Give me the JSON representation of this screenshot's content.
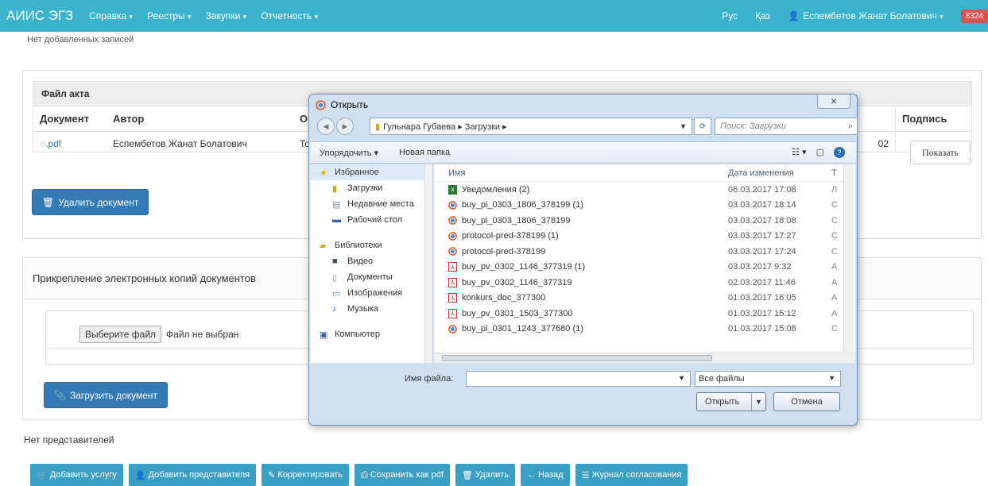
{
  "navbar": {
    "brand": "АИИС ЭГЗ",
    "menus": [
      "Справка",
      "Реестры",
      "Закупки",
      "Отчетность"
    ],
    "lang_ru": "Рус",
    "lang_kz": "Қаз",
    "user": "Еспембетов Жанат Болатович",
    "badge": "8324"
  },
  "top_note": "Нет добавленных записей",
  "act_table": {
    "title": "Файл акта",
    "headers": [
      "Документ",
      "Автор",
      "Ор",
      "",
      "Подпись"
    ],
    "row": {
      "doc": "◌.pdf",
      "author": "Еспембетов Жанат Болатович",
      "org": "То",
      "date_tail": "02"
    },
    "show_button": "Показать"
  },
  "delete_doc_button": "Удалить документ",
  "attach_panel": {
    "title": "Прикрепление электронных копий документов",
    "choose_button": "Выберите файл",
    "no_file": "Файл не выбран",
    "upload_button": "Загрузить документ"
  },
  "no_reps": "Нет представителей",
  "bottom_buttons": [
    "Добавить услугу",
    "Добавить представителя",
    "Корректировать",
    "Сохранить как pdf",
    "Удалить",
    "Назад",
    "Журнал согласования"
  ],
  "dialog": {
    "title": "Открыть",
    "close_label": "⨯",
    "path": "Гульнара Губаева ▸ Загрузки ▸",
    "search_placeholder": "Поиск: Загрузки",
    "organize": "Упорядочить ▾",
    "new_folder": "Новая папка",
    "nav": {
      "favorites": "Избранное",
      "fav_items": [
        "Загрузки",
        "Недавние места",
        "Рабочий стол"
      ],
      "libraries": "Библиотеки",
      "lib_items": [
        "Видео",
        "Документы",
        "Изображения",
        "Музыка"
      ],
      "computer": "Компьютер"
    },
    "col_name": "Имя",
    "col_date": "Дата изменения",
    "files": [
      {
        "name": "Уведомления (2)",
        "date": "06.03.2017 17:08",
        "icon": "xls-icon",
        "type": "Л"
      },
      {
        "name": "buy_pi_0303_1806_378199 (1)",
        "date": "03.03.2017 18:14",
        "icon": "chrome-icon",
        "type": "С"
      },
      {
        "name": "buy_pi_0303_1806_378199",
        "date": "03.03.2017 18:08",
        "icon": "chrome-icon",
        "type": "С"
      },
      {
        "name": "protocol-pred-378199 (1)",
        "date": "03.03.2017 17:27",
        "icon": "chrome-icon",
        "type": "С"
      },
      {
        "name": "protocol-pred-378199",
        "date": "03.03.2017 17:24",
        "icon": "chrome-icon",
        "type": "С"
      },
      {
        "name": "buy_pv_0302_1146_377319 (1)",
        "date": "03.03.2017 9:32",
        "icon": "pdf-icon",
        "type": "А"
      },
      {
        "name": "buy_pv_0302_1146_377319",
        "date": "02.03.2017 11:46",
        "icon": "pdf-icon",
        "type": "А"
      },
      {
        "name": "konkurs_doc_377300",
        "date": "01.03.2017 16:05",
        "icon": "pdf-icon",
        "type": "А"
      },
      {
        "name": "buy_pv_0301_1503_377300",
        "date": "01.03.2017 15:12",
        "icon": "pdf-icon",
        "type": "А"
      },
      {
        "name": "buy_pi_0301_1243_377680 (1)",
        "date": "01.03.2017 15:08",
        "icon": "chrome-icon",
        "type": "С"
      }
    ],
    "filename_label": "Имя файла:",
    "filetype": "Все файлы",
    "open_button": "Открыть",
    "cancel_button": "Отмена"
  }
}
